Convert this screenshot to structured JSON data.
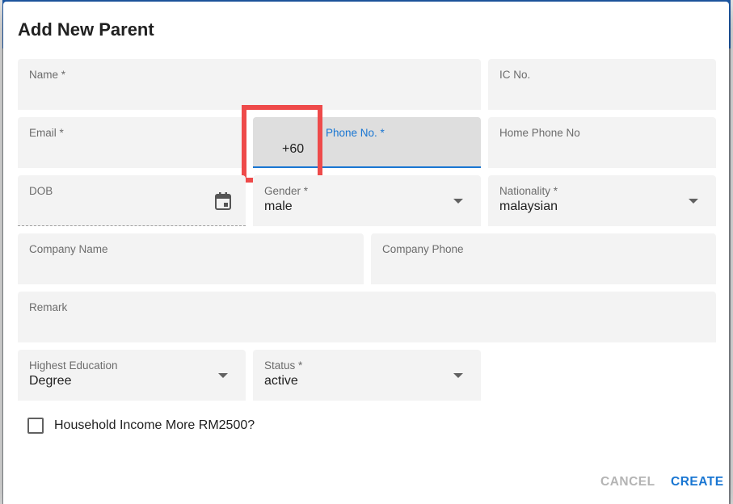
{
  "dialog": {
    "title": "Add New Parent"
  },
  "fields": {
    "name": {
      "label": "Name *",
      "value": ""
    },
    "ic_no": {
      "label": "IC No.",
      "value": ""
    },
    "email": {
      "label": "Email *",
      "value": ""
    },
    "phone": {
      "prefix": "+60",
      "label": "Phone No. *",
      "value": ""
    },
    "home_phone": {
      "label": "Home Phone No",
      "value": ""
    },
    "dob": {
      "label": "DOB",
      "value": "",
      "icon": "calendar-icon"
    },
    "gender": {
      "label": "Gender *",
      "value": "male"
    },
    "nationality": {
      "label": "Nationality *",
      "value": "malaysian"
    },
    "company_name": {
      "label": "Company Name",
      "value": ""
    },
    "company_phone": {
      "label": "Company Phone",
      "value": ""
    },
    "remark": {
      "label": "Remark",
      "value": ""
    },
    "highest_education": {
      "label": "Highest Education",
      "value": "Degree"
    },
    "status": {
      "label": "Status *",
      "value": "active"
    }
  },
  "household_income": {
    "label": "Household Income More RM2500?",
    "checked": false
  },
  "actions": {
    "cancel_label": "CANCEL",
    "create_label": "CREATE"
  },
  "colors": {
    "accent": "#1976d2",
    "highlight": "#ee4a4a",
    "field_bg": "#f3f3f3"
  }
}
